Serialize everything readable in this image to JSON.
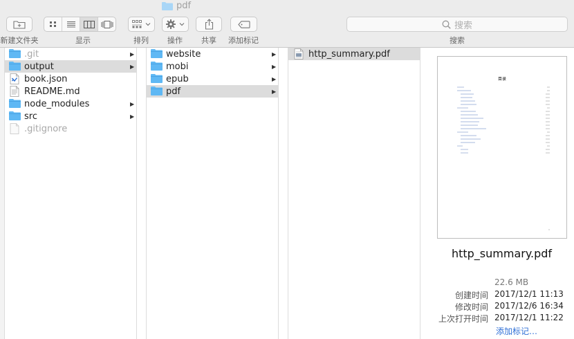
{
  "window": {
    "title": "pdf"
  },
  "toolbar": {
    "new_folder_label": "新建文件夹",
    "view_label": "显示",
    "arrange_label": "排列",
    "action_label": "操作",
    "share_label": "共享",
    "tags_label": "添加标记",
    "search_label": "搜索",
    "search_placeholder": "搜索"
  },
  "columns": [
    {
      "items": [
        {
          "name": ".git",
          "type": "folder",
          "has_children": true,
          "selected": false,
          "dim": true
        },
        {
          "name": "output",
          "type": "folder",
          "has_children": true,
          "selected": true,
          "dim": false
        },
        {
          "name": "book.json",
          "type": "json-file",
          "has_children": false,
          "selected": false,
          "dim": false
        },
        {
          "name": "README.md",
          "type": "text-file",
          "has_children": false,
          "selected": false,
          "dim": false
        },
        {
          "name": "node_modules",
          "type": "folder",
          "has_children": true,
          "selected": false,
          "dim": false
        },
        {
          "name": "src",
          "type": "folder",
          "has_children": true,
          "selected": false,
          "dim": false
        },
        {
          "name": ".gitignore",
          "type": "blank-file",
          "has_children": false,
          "selected": false,
          "dim": true
        }
      ]
    },
    {
      "items": [
        {
          "name": "website",
          "type": "folder",
          "has_children": true,
          "selected": false,
          "dim": false
        },
        {
          "name": "mobi",
          "type": "folder",
          "has_children": true,
          "selected": false,
          "dim": false
        },
        {
          "name": "epub",
          "type": "folder",
          "has_children": true,
          "selected": false,
          "dim": false
        },
        {
          "name": "pdf",
          "type": "folder",
          "has_children": true,
          "selected": true,
          "dim": false
        }
      ]
    },
    {
      "items": [
        {
          "name": "http_summary.pdf",
          "type": "pdf-file",
          "has_children": false,
          "selected": true,
          "dim": false
        }
      ]
    }
  ],
  "preview": {
    "thumb_title": "目录",
    "filename": "http_summary.pdf",
    "size": "22.6 MB",
    "created_label": "创建时间",
    "created": "2017/12/1 11:13",
    "modified_label": "修改时间",
    "modified": "2017/12/6 16:34",
    "opened_label": "上次打开时间",
    "opened": "2017/12/1 11:22",
    "add_tags": "添加标记…"
  },
  "colors": {
    "folder": "#5fb8f4",
    "selection": "#dcdcdc",
    "link": "#2f6fd6"
  }
}
